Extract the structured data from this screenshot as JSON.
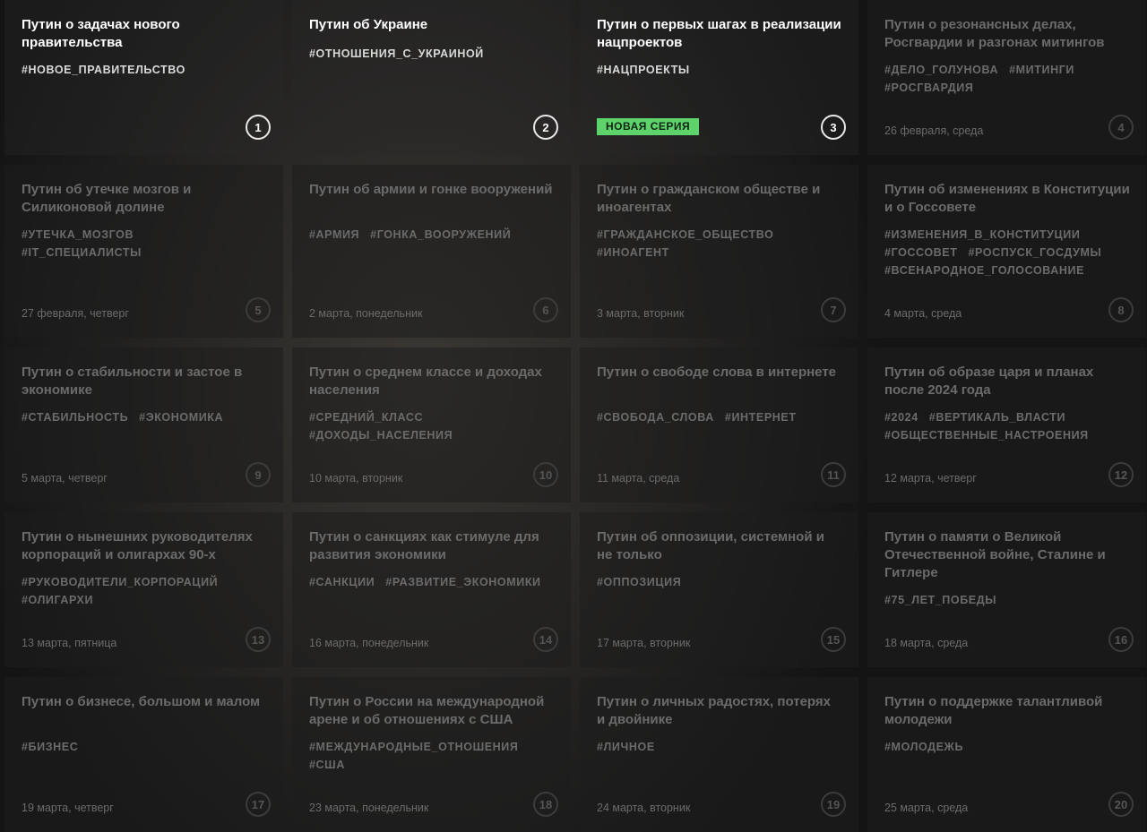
{
  "episodes": [
    {
      "title": "Путин о задачах нового правительства",
      "tags": [
        "#НОВОЕ_ПРАВИТЕЛЬСТВО"
      ],
      "date": "",
      "number": "1",
      "active": true
    },
    {
      "title": "Путин об Украине",
      "tags": [
        "#ОТНОШЕНИЯ_С_УКРАИНОЙ"
      ],
      "date": "",
      "number": "2",
      "active": true
    },
    {
      "title": "Путин о первых шагах в реализации нацпроектов",
      "tags": [
        "#НАЦПРОЕКТЫ"
      ],
      "date": "",
      "number": "3",
      "active": true,
      "badge": "НОВАЯ СЕРИЯ"
    },
    {
      "title": "Путин о резонансных делах, Росгвардии и разгонах митингов",
      "tags": [
        "#ДЕЛО_ГОЛУНОВА",
        "#МИТИНГИ",
        "#РОСГВАРДИЯ"
      ],
      "date": "26 февраля, среда",
      "number": "4",
      "active": false
    },
    {
      "title": "Путин об утечке мозгов и Силиконовой долине",
      "tags": [
        "#УТЕЧКА_МОЗГОВ",
        "#IT_СПЕЦИАЛИСТЫ"
      ],
      "date": "27 февраля, четверг",
      "number": "5",
      "active": false
    },
    {
      "title": "Путин об армии и гонке вооружений",
      "tags": [
        "#АРМИЯ",
        "#ГОНКА_ВООРУЖЕНИЙ"
      ],
      "date": "2 марта, понедельник",
      "number": "6",
      "active": false
    },
    {
      "title": "Путин о гражданском обществе и иноагентах",
      "tags": [
        "#ГРАЖДАНСКОЕ_ОБЩЕСТВО",
        "#ИНОАГЕНТ"
      ],
      "date": "3 марта, вторник",
      "number": "7",
      "active": false
    },
    {
      "title": "Путин об изменениях в Конституции и о Госсовете",
      "tags": [
        "#ИЗМЕНЕНИЯ_В_КОНСТИТУЦИИ",
        "#ГОССОВЕТ",
        "#РОСПУСК_ГОСДУМЫ",
        "#ВСЕНАРОДНОЕ_ГОЛОСОВАНИЕ"
      ],
      "date": "4 марта, среда",
      "number": "8",
      "active": false
    },
    {
      "title": "Путин о стабильности и застое в экономике",
      "tags": [
        "#СТАБИЛЬНОСТЬ",
        "#ЭКОНОМИКА"
      ],
      "date": "5 марта, четверг",
      "number": "9",
      "active": false
    },
    {
      "title": "Путин о среднем классе и доходах населения",
      "tags": [
        "#СРЕДНИЙ_КЛАСС",
        "#ДОХОДЫ_НАСЕЛЕНИЯ"
      ],
      "date": "10 марта, вторник",
      "number": "10",
      "active": false
    },
    {
      "title": "Путин о свободе слова в интернете",
      "tags": [
        "#СВОБОДА_СЛОВА",
        "#ИНТЕРНЕТ"
      ],
      "date": "11 марта, среда",
      "number": "11",
      "active": false
    },
    {
      "title": "Путин об образе царя и планах после 2024 года",
      "tags": [
        "#2024",
        "#ВЕРТИКАЛЬ_ВЛАСТИ",
        "#ОБЩЕСТВЕННЫЕ_НАСТРОЕНИЯ"
      ],
      "date": "12 марта, четверг",
      "number": "12",
      "active": false
    },
    {
      "title": "Путин о нынешних руководителях корпораций и олигархах 90-х",
      "tags": [
        "#РУКОВОДИТЕЛИ_КОРПОРАЦИЙ",
        "#ОЛИГАРХИ"
      ],
      "date": "13 марта, пятница",
      "number": "13",
      "active": false
    },
    {
      "title": "Путин о санкциях как стимуле для развития экономики",
      "tags": [
        "#САНКЦИИ",
        "#РАЗВИТИЕ_ЭКОНОМИКИ"
      ],
      "date": "16 марта, понедельник",
      "number": "14",
      "active": false
    },
    {
      "title": "Путин об оппозиции, системной и не только",
      "tags": [
        "#ОППОЗИЦИЯ"
      ],
      "date": "17 марта, вторник",
      "number": "15",
      "active": false
    },
    {
      "title": "Путин о памяти о Великой Отечественной войне, Сталине и Гитлере",
      "tags": [
        "#75_ЛЕТ_ПОБЕДЫ"
      ],
      "date": "18 марта, среда",
      "number": "16",
      "active": false
    },
    {
      "title": "Путин о бизнесе, большом и малом",
      "tags": [
        "#БИЗНЕС"
      ],
      "date": "19 марта, четверг",
      "number": "17",
      "active": false
    },
    {
      "title": "Путин о России на международной арене и об отношениях с США",
      "tags": [
        "#МЕЖДУНАРОДНЫЕ_ОТНОШЕНИЯ",
        "#США"
      ],
      "date": "23 марта, понедельник",
      "number": "18",
      "active": false
    },
    {
      "title": "Путин о личных радостях, потерях и двойнике",
      "tags": [
        "#ЛИЧНОЕ"
      ],
      "date": "24 марта, вторник",
      "number": "19",
      "active": false
    },
    {
      "title": "Путин о поддержке талантливой молодежи",
      "tags": [
        "#МОЛОДЕЖЬ"
      ],
      "date": "25 марта, среда",
      "number": "20",
      "active": false
    }
  ]
}
